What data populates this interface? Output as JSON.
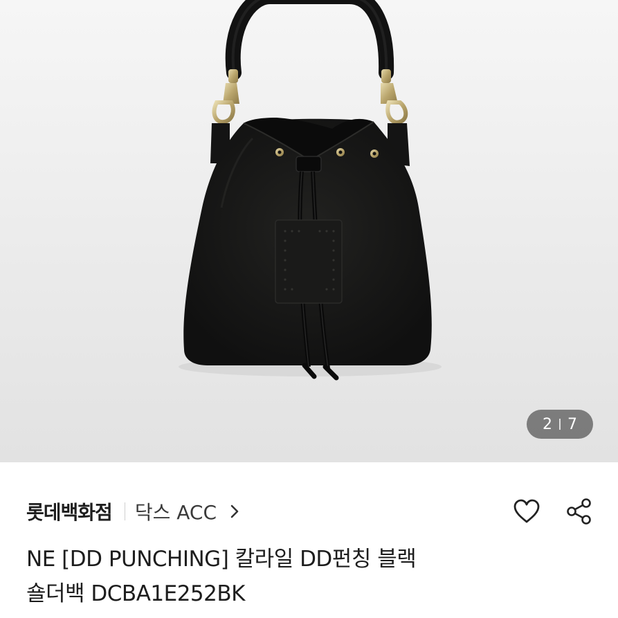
{
  "gallery": {
    "image_alt": "black bucket shoulder bag with drawstring",
    "current_index": "2",
    "total": "7"
  },
  "shop": {
    "store_name": "롯데백화점",
    "brand_link_label": "닥스 ACC"
  },
  "product": {
    "title_line1": "NE [DD PUNCHING] 칼라일 DD펀칭 블랙",
    "title_line2": "숄더백 DCBA1E252BK"
  },
  "icons": {
    "chevron": "chevron-right-icon",
    "like": "heart-icon",
    "share": "share-icon"
  },
  "colors": {
    "bag": "#151515",
    "counter_bg": "#3c3c3c"
  }
}
